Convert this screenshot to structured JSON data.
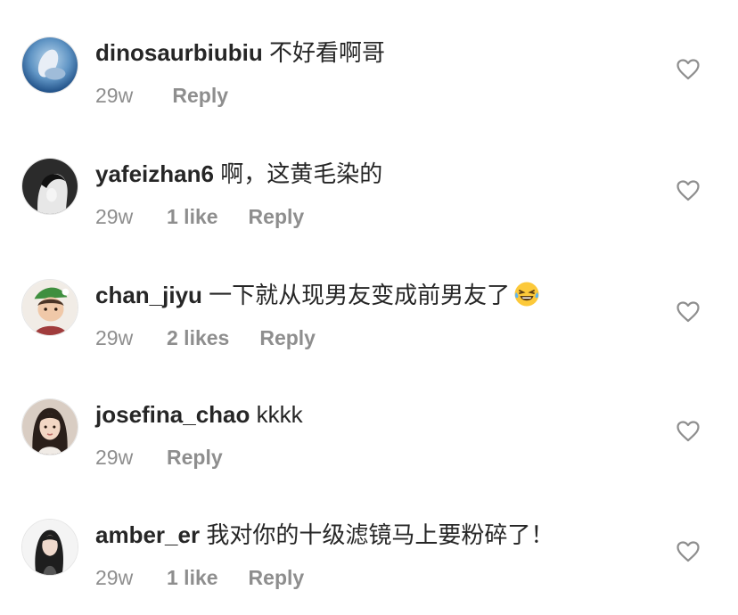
{
  "comments": [
    {
      "username": "dinosaurbiubiu",
      "text": "不好看啊哥",
      "time": "29w",
      "likes": "",
      "reply": "Reply",
      "avatar": "ocean-avatar",
      "like_icon": "heart-outline-icon"
    },
    {
      "username": "yafeizhan6",
      "text": "啊，这黄毛染的",
      "time": "29w",
      "likes": "1 like",
      "reply": "Reply",
      "avatar": "monochrome-portrait-avatar",
      "like_icon": "heart-outline-icon"
    },
    {
      "username": "chan_jiyu",
      "text": "一下就从现男友变成前男友了",
      "emoji": "😂",
      "time": "29w",
      "likes": "2 likes",
      "reply": "Reply",
      "avatar": "child-green-hat-avatar",
      "like_icon": "heart-outline-icon"
    },
    {
      "username": "josefina_chao",
      "text": "kkkk",
      "time": "29w",
      "likes": "",
      "reply": "Reply",
      "avatar": "woman-portrait-avatar",
      "like_icon": "heart-outline-icon"
    },
    {
      "username": "amber_er",
      "text": "我对你的十级滤镜马上要粉碎了！",
      "time": "29w",
      "likes": "1 like",
      "reply": "Reply",
      "avatar": "woman-dark-hair-avatar",
      "like_icon": "heart-outline-icon"
    }
  ],
  "colors": {
    "text_primary": "#262626",
    "text_secondary": "#8e8e8e",
    "background": "#ffffff",
    "heart_stroke": "#8e8e8e"
  }
}
